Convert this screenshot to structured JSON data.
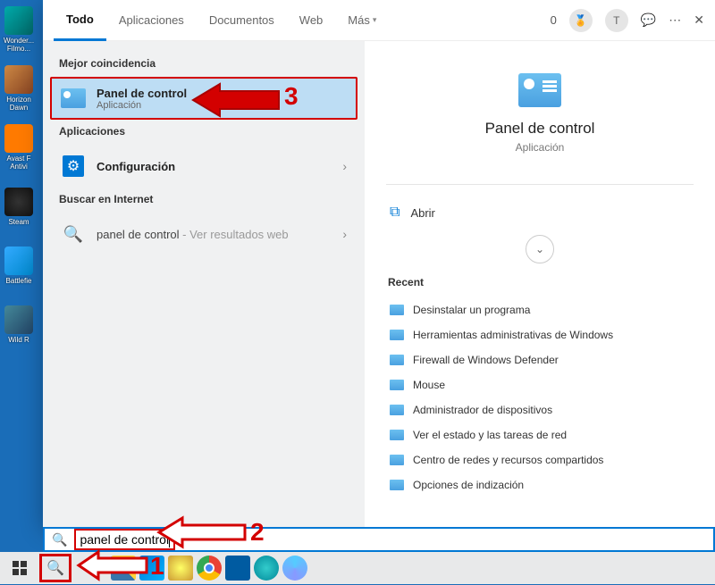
{
  "desktop": {
    "icons": [
      {
        "label": "Wonder... Filmo...",
        "cls": "ico-filmora"
      },
      {
        "label": "Horizon Dawn",
        "cls": "ico-horizon"
      },
      {
        "label": "Avast F Antivi",
        "cls": "ico-avast"
      },
      {
        "label": "Steam",
        "cls": "ico-steam"
      },
      {
        "label": "Battlefie",
        "cls": "ico-bf"
      },
      {
        "label": "Wild R",
        "cls": "ico-wild"
      }
    ]
  },
  "tabs": {
    "items": [
      "Todo",
      "Aplicaciones",
      "Documentos",
      "Web",
      "Más"
    ],
    "active_index": 0,
    "right_digit": "0",
    "avatar_letter": "T"
  },
  "left": {
    "best_match_label": "Mejor coincidencia",
    "best_match": {
      "title": "Panel de control",
      "subtitle": "Aplicación"
    },
    "apps_label": "Aplicaciones",
    "apps": [
      {
        "title": "Configuración"
      }
    ],
    "web_label": "Buscar en Internet",
    "web": {
      "query": "panel de control",
      "suffix": " - Ver resultados web"
    }
  },
  "detail": {
    "title": "Panel de control",
    "subtitle": "Aplicación",
    "open_label": "Abrir",
    "recent_label": "Recent",
    "recent": [
      "Desinstalar un programa",
      "Herramientas administrativas de Windows",
      "Firewall de Windows Defender",
      "Mouse",
      "Administrador de dispositivos",
      "Ver el estado y las tareas de red",
      "Centro de redes y recursos compartidos",
      "Opciones de indización"
    ]
  },
  "search": {
    "value": "panel de control"
  },
  "annotations": {
    "n1": "1",
    "n2": "2",
    "n3": "3"
  }
}
